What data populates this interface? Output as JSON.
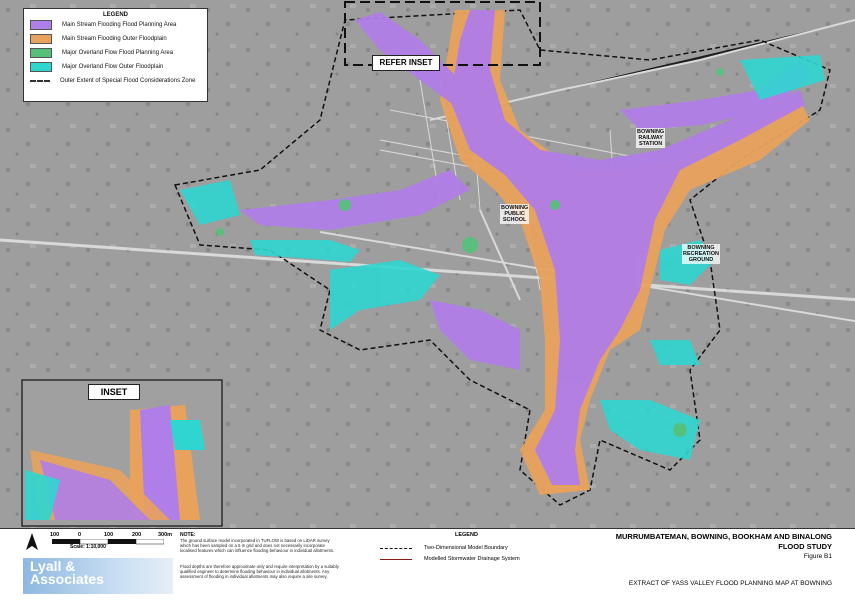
{
  "legend": {
    "title": "LEGEND",
    "items": [
      {
        "label": "Main Stream Flooding Flood Planning Area",
        "color": "#b07ee8"
      },
      {
        "label": "Main Stream Flooding Outer Floodplain",
        "color": "#e9a25c"
      },
      {
        "label": "Major Overland Flow Flood Planning Area",
        "color": "#56c07a"
      },
      {
        "label": "Major Overland Flow Outer Floodplain",
        "color": "#2fd6d0"
      },
      {
        "label": "Outer Extent of Special Flood Considerations Zone",
        "color": "#333333"
      }
    ]
  },
  "map": {
    "inset_label": "INSET",
    "refer_inset_label": "REFER INSET",
    "places": {
      "bowning_railway_station": "BOWNING\nRAILWAY\nSTATION",
      "bowning_public_school": "BOWNING\nPUBLIC\nSCHOOL",
      "bowning_recreation_ground": "BOWNING\nRECREATION\nGROUND"
    }
  },
  "footer": {
    "scale_ticks": [
      "100",
      "0",
      "100",
      "200",
      "300m"
    ],
    "scale_text": "Scale: 1:10,000",
    "note_title": "NOTE:",
    "note1": "The ground surface model incorporated in TUFLOW is based on LiDAR survey which has been sampled on a 5 m grid and does not necessarily incorporate localised features which can influence flooding behaviour in individual allotments.",
    "note2": "Flood depths are therefore approximate only and require interpretation by a suitably qualified engineer to determine flooding behaviour in individual allotments. Any assessment of flooding in individual allotments may also require a site survey.",
    "logo": "Lyall &\nAssociates",
    "legend2_title": "LEGEND",
    "legend2_items": [
      "Two-Dimensional Model Boundary",
      "Modelled Stormwater Drainage System"
    ],
    "title_main": "MURRUMBATEMAN, BOWNING, BOOKHAM AND BINALONG",
    "title_sub": "FLOOD STUDY",
    "figure": "Figure B1",
    "extract": "EXTRACT OF YASS VALLEY FLOOD PLANNING MAP AT BOWNING"
  }
}
